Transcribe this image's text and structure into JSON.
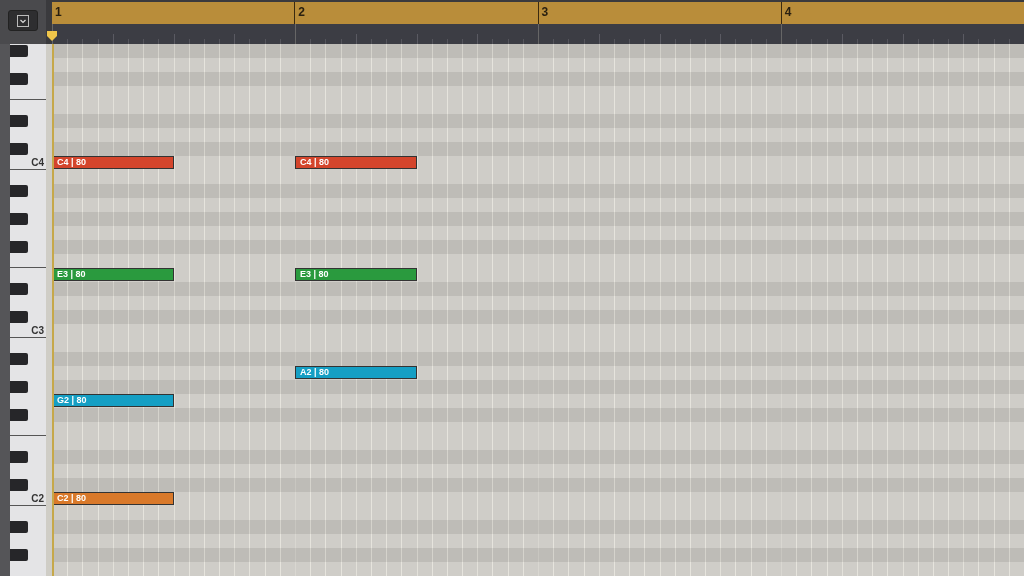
{
  "ruler": {
    "bars": [
      "1",
      "2",
      "3",
      "4"
    ]
  },
  "rows": [
    {
      "black": true
    },
    {
      "black": false
    },
    {
      "black": true
    },
    {
      "black": false
    },
    {
      "black": false
    },
    {
      "black": true
    },
    {
      "black": false
    },
    {
      "black": true
    },
    {
      "black": false,
      "label": "C4",
      "bar_1_note": {
        "label": "C4 | 80",
        "color": "#d4452c"
      },
      "bar_2_note": {
        "label": "C4 | 80",
        "color": "#d4452c"
      }
    },
    {
      "black": false
    },
    {
      "black": true
    },
    {
      "black": false
    },
    {
      "black": true
    },
    {
      "black": false
    },
    {
      "black": true
    },
    {
      "black": false
    },
    {
      "black": false,
      "bar_1_note": {
        "label": "E3 | 80",
        "color": "#2a9a3e"
      },
      "bar_2_note": {
        "label": "E3 | 80",
        "color": "#2a9a3e"
      }
    },
    {
      "black": true
    },
    {
      "black": false
    },
    {
      "black": true
    },
    {
      "black": false,
      "label": "C3"
    },
    {
      "black": false
    },
    {
      "black": true
    },
    {
      "black": false,
      "bar_2_note": {
        "label": "A2 | 80",
        "color": "#159fc4"
      }
    },
    {
      "black": true
    },
    {
      "black": false,
      "bar_1_note": {
        "label": "G2 | 80",
        "color": "#159fc4"
      }
    },
    {
      "black": true
    },
    {
      "black": false
    },
    {
      "black": false
    },
    {
      "black": true
    },
    {
      "black": false
    },
    {
      "black": true
    },
    {
      "black": false,
      "label": "C2",
      "bar_1_note": {
        "label": "C2 | 80",
        "color": "#d9792a"
      }
    },
    {
      "black": false
    },
    {
      "black": true
    },
    {
      "black": false
    },
    {
      "black": true
    },
    {
      "black": false
    }
  ]
}
